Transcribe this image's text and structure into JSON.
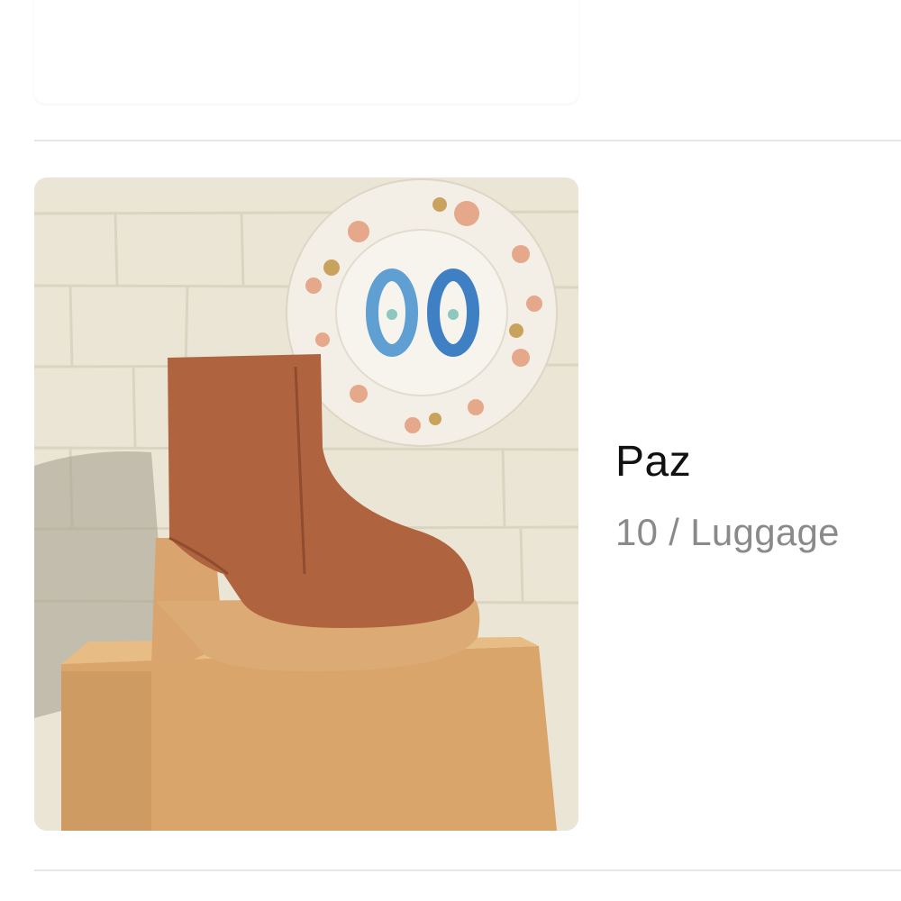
{
  "previous_item": {
    "image_icon": "product-image"
  },
  "item": {
    "image_icon": "ankle-boot-image",
    "name": "Paz",
    "size_label": "10 / Luggage"
  },
  "colors": {
    "divider": "#e7e7e7",
    "name_text": "#111111",
    "meta_text": "#8a8a8a",
    "wall": "#ebe5d5",
    "boot_leather": "#b0633f",
    "wood": "#d8a772"
  }
}
